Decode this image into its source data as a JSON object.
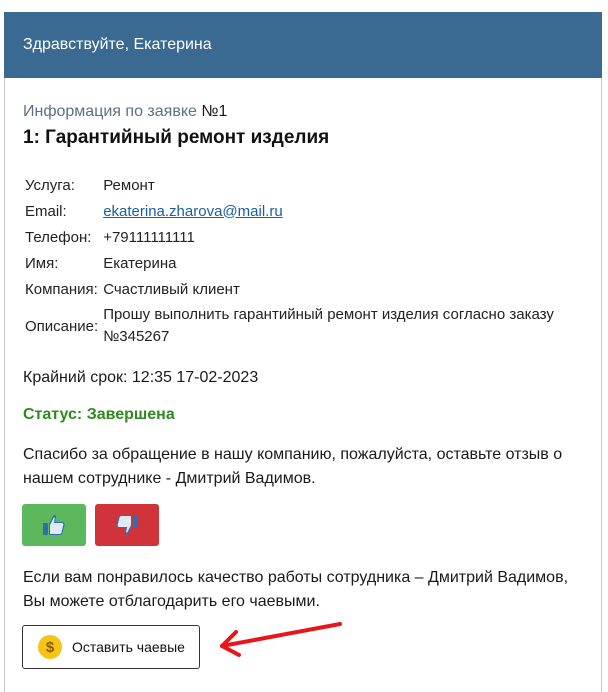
{
  "header": {
    "greeting": "Здравствуйте, Екатерина"
  },
  "request": {
    "info_label": "Информация по заявке",
    "info_number": "№1",
    "title": "1: Гарантийный ремонт изделия"
  },
  "details": {
    "service_label": "Услуга:",
    "service_value": "Ремонт",
    "email_label": "Email:",
    "email_value": "ekaterina.zharova@mail.ru",
    "phone_label": "Телефон:",
    "phone_value": "+79111111111",
    "name_label": "Имя:",
    "name_value": "Екатерина",
    "company_label": "Компания:",
    "company_value": "Счастливый клиент",
    "description_label": "Описание:",
    "description_value": "Прошу выполнить гарантийный ремонт изделия согласно заказу №345267"
  },
  "deadline": "Крайний срок: 12:35 17-02-2023",
  "status": "Статус: Завершена",
  "feedback": {
    "thanks_text": "Спасибо за обращение в нашу компанию, пожалуйста, оставьте отзыв о нашем сотруднике - Дмитрий Вадимов.",
    "like_icon": "thumbs-up-icon",
    "dislike_icon": "thumbs-down-icon"
  },
  "tips": {
    "text": "Если вам понравилось качество работы сотрудника – Дмитрий Вадимов, Вы можете отблагодарить его чаевыми.",
    "button_label": "Оставить чаевые",
    "coin_symbol": "$"
  },
  "colors": {
    "header": "#3a6a92",
    "status": "#2e8a1e",
    "like": "#5cb85c",
    "dislike": "#d0343a",
    "arrow": "#e8161b"
  }
}
